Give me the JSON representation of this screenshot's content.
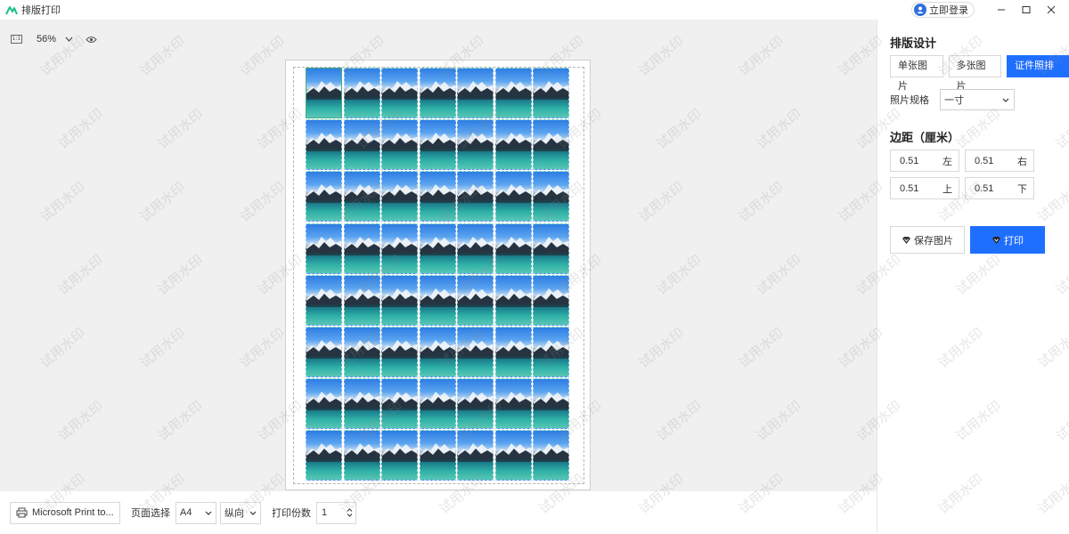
{
  "window": {
    "title": "排版打印",
    "login_label": "立即登录"
  },
  "toolbar": {
    "ratio_label": "1:1",
    "zoom": "56%"
  },
  "panel": {
    "layout_title": "排版设计",
    "tabs": [
      {
        "label": "单张图片",
        "active": false
      },
      {
        "label": "多张图片",
        "active": false
      },
      {
        "label": "证件照排版",
        "active": true
      }
    ],
    "spec_label": "照片规格",
    "spec_value": "一寸",
    "margin_title": "边距（厘米）",
    "margins": [
      {
        "value": "0.51",
        "side": "左"
      },
      {
        "value": "0.51",
        "side": "右"
      },
      {
        "value": "0.51",
        "side": "上"
      },
      {
        "value": "0.51",
        "side": "下"
      }
    ],
    "save_label": "保存图片",
    "print_label": "打印"
  },
  "bottom": {
    "printer": "Microsoft Print to...",
    "page_label": "页面选择",
    "paper": "A4",
    "orientation": "纵向",
    "copies_label": "打印份数",
    "copies": "1"
  },
  "sheet": {
    "columns": 7,
    "rows": 8,
    "selected_index": 0
  },
  "watermark_text": "试用水印",
  "colors": {
    "accent": "#1f6fff",
    "logo": "#1bbf8a"
  }
}
